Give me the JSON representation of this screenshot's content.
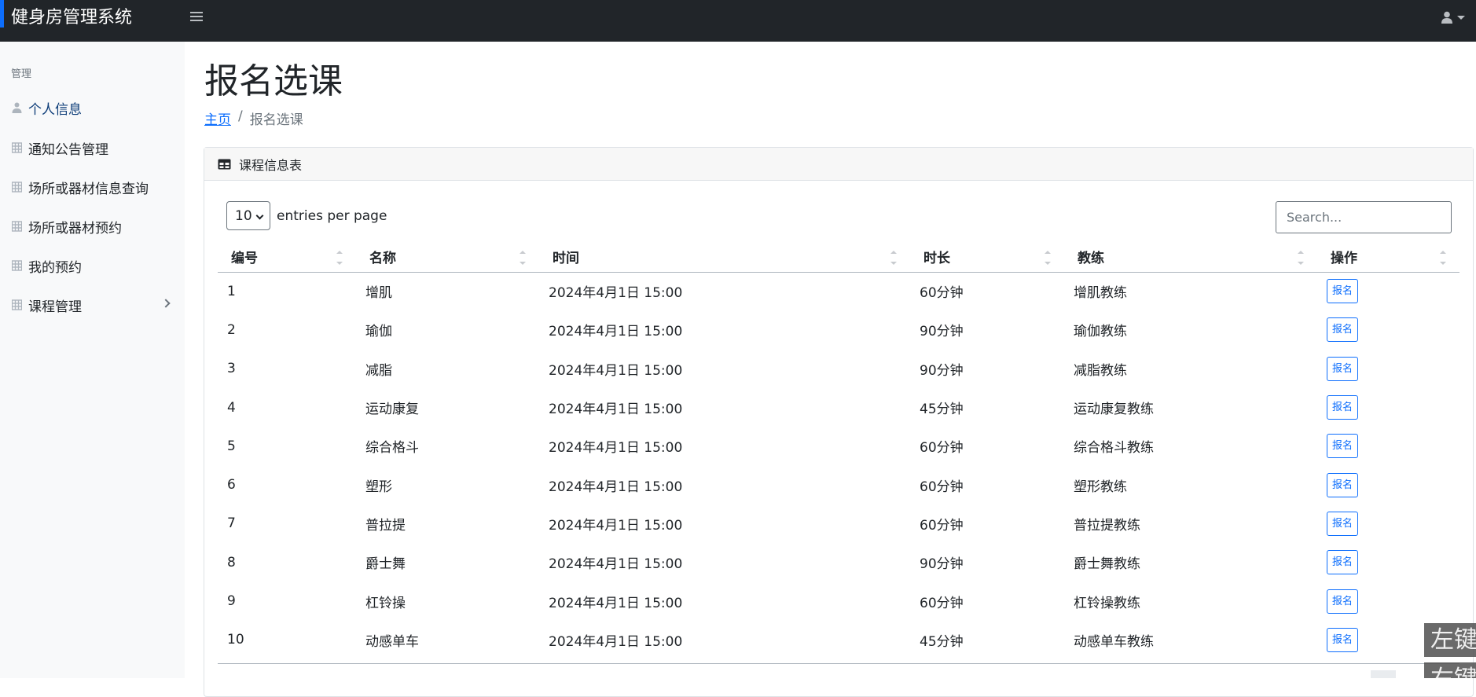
{
  "app": {
    "brand": "健身房管理系统"
  },
  "sidebar": {
    "heading": "管理",
    "items": [
      {
        "label": "个人信息",
        "icon": "user-icon"
      },
      {
        "label": "通知公告管理",
        "icon": "table-icon"
      },
      {
        "label": "场所或器材信息查询",
        "icon": "table-icon"
      },
      {
        "label": "场所或器材预约",
        "icon": "table-icon"
      },
      {
        "label": "我的预约",
        "icon": "table-icon"
      },
      {
        "label": "课程管理",
        "icon": "table-icon"
      }
    ]
  },
  "page": {
    "title": "报名选课",
    "breadcrumb": {
      "home": "主页",
      "current": "报名选课"
    }
  },
  "card": {
    "title": "课程信息表"
  },
  "controls": {
    "entries_value": "10",
    "entries_label": "entries per page",
    "search_placeholder": "Search..."
  },
  "table": {
    "columns": [
      "编号",
      "名称",
      "时间",
      "时长",
      "教练",
      "操作"
    ],
    "action_label": "报名",
    "rows": [
      [
        "1",
        "增肌",
        "2024年4月1日 15:00",
        "60分钟",
        "增肌教练"
      ],
      [
        "2",
        "瑜伽",
        "2024年4月1日 15:00",
        "90分钟",
        "瑜伽教练"
      ],
      [
        "3",
        "减脂",
        "2024年4月1日 15:00",
        "90分钟",
        "减脂教练"
      ],
      [
        "4",
        "运动康复",
        "2024年4月1日 15:00",
        "45分钟",
        "运动康复教练"
      ],
      [
        "5",
        "综合格斗",
        "2024年4月1日 15:00",
        "60分钟",
        "综合格斗教练"
      ],
      [
        "6",
        "塑形",
        "2024年4月1日 15:00",
        "60分钟",
        "塑形教练"
      ],
      [
        "7",
        "普拉提",
        "2024年4月1日 15:00",
        "60分钟",
        "普拉提教练"
      ],
      [
        "8",
        "爵士舞",
        "2024年4月1日 15:00",
        "90分钟",
        "爵士舞教练"
      ],
      [
        "9",
        "杠铃操",
        "2024年4月1日 15:00",
        "60分钟",
        "杠铃操教练"
      ],
      [
        "10",
        "动感单车",
        "2024年4月1日 15:00",
        "45分钟",
        "动感单车教练"
      ]
    ]
  },
  "overlay": {
    "text1": "左键",
    "text2": "右键"
  },
  "colors": {
    "navbar": "#212529",
    "sidebar": "#f8f9fa",
    "primary": "#0d6efd"
  }
}
